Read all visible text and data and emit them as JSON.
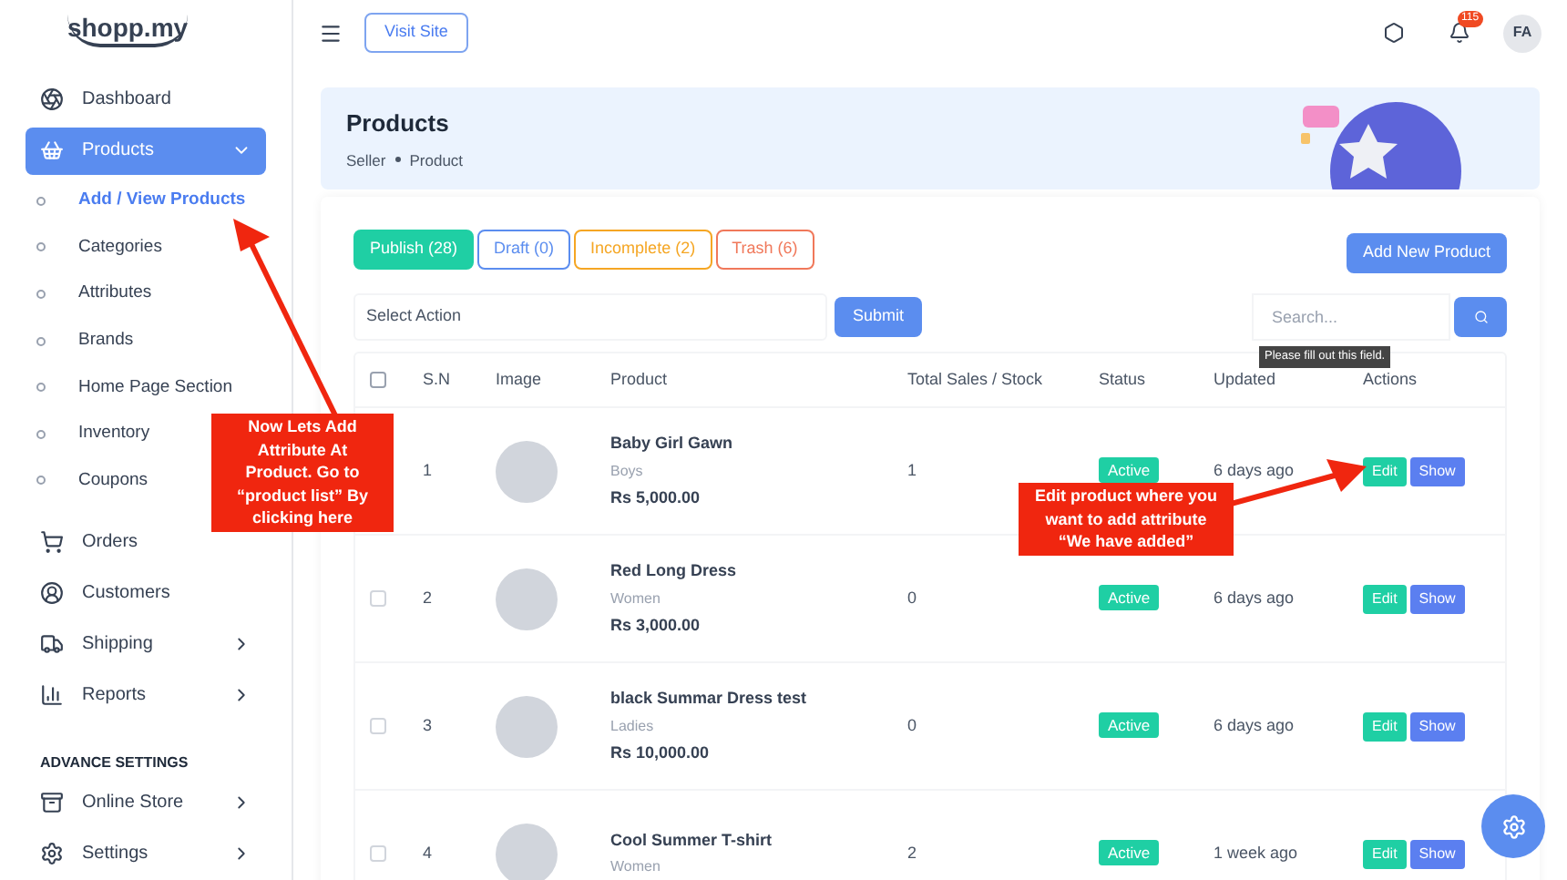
{
  "logo": {
    "text": "shopp.my"
  },
  "sidebar": {
    "items": [
      {
        "kind": "item",
        "label": "Dashboard",
        "selected": false
      },
      {
        "kind": "item",
        "label": "Products",
        "selected": true,
        "expanded": true,
        "children": [
          {
            "label": "Add / View Products",
            "selected": true
          },
          {
            "label": "Categories",
            "selected": false
          },
          {
            "label": "Attributes",
            "selected": false
          },
          {
            "label": "Brands",
            "selected": false
          },
          {
            "label": "Home Page Section",
            "selected": false
          },
          {
            "label": "Inventory",
            "selected": false
          },
          {
            "label": "Coupons",
            "selected": false
          }
        ]
      },
      {
        "kind": "item",
        "label": "Orders",
        "selected": false
      },
      {
        "kind": "item",
        "label": "Customers",
        "selected": false
      },
      {
        "kind": "item",
        "label": "Shipping",
        "selected": false,
        "expanded": false
      },
      {
        "kind": "item",
        "label": "Reports",
        "selected": false,
        "expanded": false
      },
      {
        "kind": "heading",
        "label": "ADVANCE SETTINGS"
      },
      {
        "kind": "item",
        "label": "Online Store",
        "selected": false,
        "expanded": false
      },
      {
        "kind": "item",
        "label": "Settings",
        "selected": false,
        "expanded": false
      }
    ]
  },
  "header": {
    "visit_button": "Visit Site",
    "notification_count": "115",
    "avatar": "FA"
  },
  "banner": {
    "title": "Products",
    "breadcrumb": [
      "Seller",
      "Product"
    ]
  },
  "tabs": [
    {
      "label": "Publish (28)",
      "selected": true,
      "color": "#1fcfa4"
    },
    {
      "label": "Draft (0)",
      "selected": false,
      "color": "#5b8def"
    },
    {
      "label": "Incomplete (2)",
      "selected": false,
      "color": "#f5a623"
    },
    {
      "label": "Trash (6)",
      "selected": false,
      "color": "#f0785a"
    }
  ],
  "add_button": "Add New Product",
  "action_select": {
    "value": "Select Action"
  },
  "submit_button": "Submit",
  "search": {
    "placeholder": "Search...",
    "tooltip": "Please fill out this field."
  },
  "table": {
    "all_checked": false,
    "columns": [
      "S.N",
      "Image",
      "Product",
      "Total Sales / Stock",
      "Status",
      "Updated",
      "Actions"
    ],
    "rows": [
      {
        "sn": "1",
        "name": "Baby Girl Gawn",
        "category": "Boys",
        "price": "Rs 5,000.00",
        "sales": "1",
        "status": "Active",
        "updated": "6 days ago",
        "actions": [
          "Edit",
          "Show"
        ]
      },
      {
        "checked": false,
        "sn": "2",
        "name": "Red Long Dress",
        "category": "Women",
        "price": "Rs 3,000.00",
        "sales": "0",
        "status": "Active",
        "updated": "6 days ago",
        "actions": [
          "Edit",
          "Show"
        ]
      },
      {
        "checked": false,
        "sn": "3",
        "name": "black Summar Dress test",
        "category": "Ladies",
        "price": "Rs 10,000.00",
        "sales": "0",
        "status": "Active",
        "updated": "6 days ago",
        "actions": [
          "Edit",
          "Show"
        ]
      },
      {
        "checked": false,
        "sn": "4",
        "name": "Cool Summer T-shirt",
        "category": "Women",
        "sales": "2",
        "status": "Active",
        "updated": "1 week ago",
        "actions": [
          "Edit",
          "Show"
        ]
      }
    ]
  },
  "annotations": [
    {
      "text": "Now Lets Add Attribute At Product. Go to “product list” By clicking here"
    },
    {
      "text": "Edit product where you want to add attribute “We have added”"
    }
  ]
}
